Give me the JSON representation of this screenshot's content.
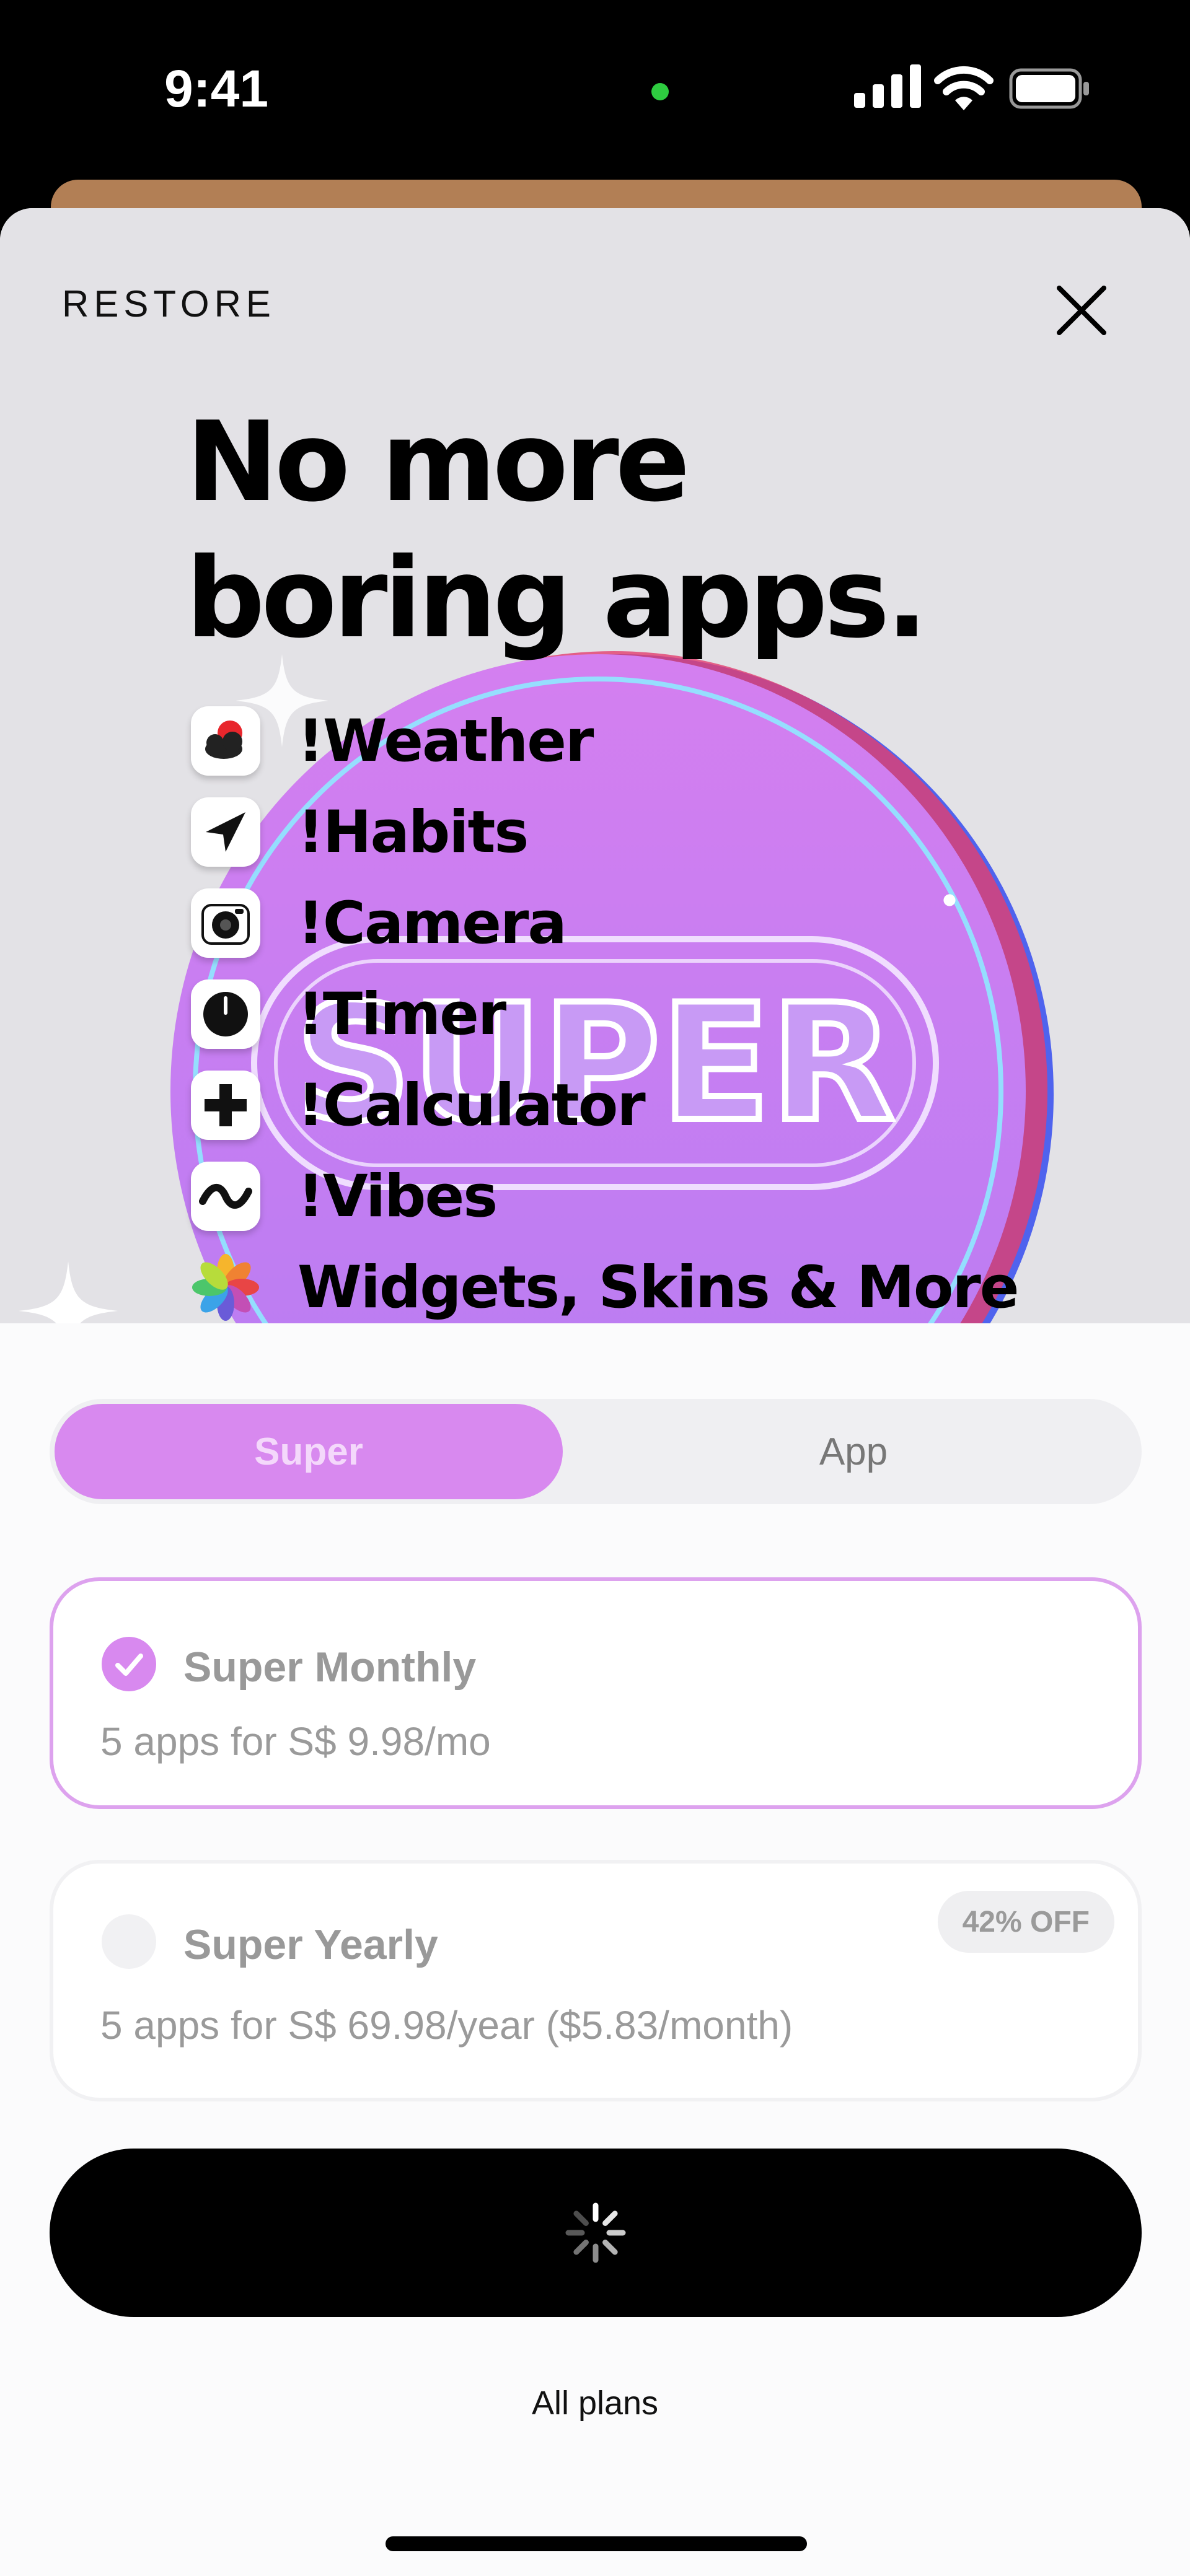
{
  "status_bar": {
    "time": "9:41"
  },
  "header": {
    "restore_label": "RESTORE"
  },
  "hero": {
    "headline_line1": "No more",
    "headline_line2": "boring apps.",
    "coin_text": "SUPER",
    "features": [
      {
        "label": "!Weather",
        "icon": "weather-icon"
      },
      {
        "label": "!Habits",
        "icon": "habits-icon"
      },
      {
        "label": "!Camera",
        "icon": "camera-icon"
      },
      {
        "label": "!Timer",
        "icon": "timer-icon"
      },
      {
        "label": "!Calculator",
        "icon": "calculator-icon"
      },
      {
        "label": "!Vibes",
        "icon": "vibes-icon"
      },
      {
        "label": "Widgets, Skins & More",
        "icon": "widgets-icon"
      }
    ]
  },
  "toggle": {
    "super_label": "Super",
    "app_label": "App",
    "selected": "Super"
  },
  "plans": [
    {
      "title": "Super Monthly",
      "description": "5 apps for S$ 9.98/mo",
      "selected": true
    },
    {
      "title": "Super Yearly",
      "description": "5 apps for S$ 69.98/year ($5.83/month)",
      "badge": "42% OFF",
      "selected": false
    }
  ],
  "cta": {
    "state": "loading"
  },
  "footer": {
    "all_plans_label": "All plans"
  },
  "colors": {
    "accent": "#d889ef",
    "accent_border": "#dda2ee",
    "cta": "#000000"
  }
}
